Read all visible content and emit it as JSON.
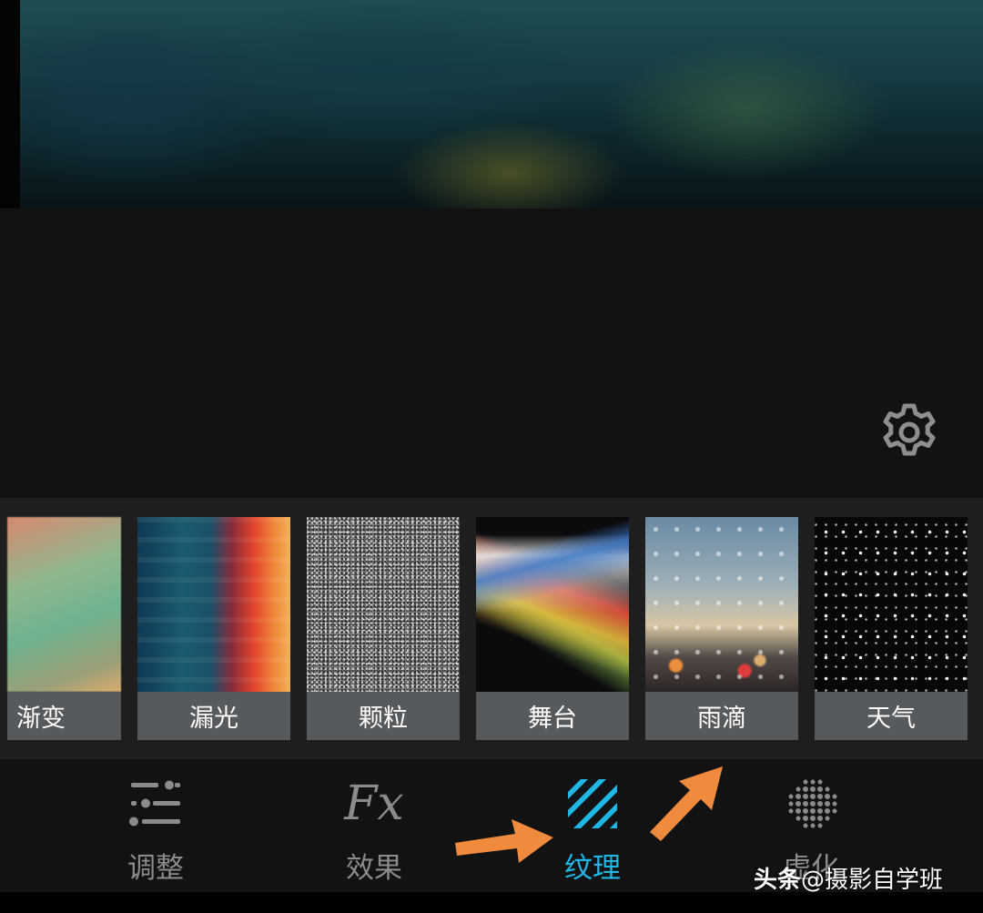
{
  "preview": {
    "image": "night-forest-photo"
  },
  "settings": {
    "icon": "gear-icon"
  },
  "textures": [
    {
      "label": "渐变",
      "thumb": "gradient"
    },
    {
      "label": "漏光",
      "thumb": "light-leak"
    },
    {
      "label": "颗粒",
      "thumb": "grain"
    },
    {
      "label": "舞台",
      "thumb": "stage"
    },
    {
      "label": "雨滴",
      "thumb": "raindrops"
    },
    {
      "label": "天气",
      "thumb": "weather"
    }
  ],
  "nav": {
    "items": [
      {
        "label": "调整",
        "icon": "sliders-icon"
      },
      {
        "label": "效果",
        "icon": "fx-icon",
        "glyph": "Fx"
      },
      {
        "label": "纹理",
        "icon": "texture-stripes-icon",
        "active": true
      },
      {
        "label": "虚化",
        "icon": "dot-grid-icon"
      }
    ]
  },
  "annotations": {
    "arrow_color": "#f08a3c"
  },
  "watermark": {
    "brand": "头条",
    "text": "@摄影自学班"
  },
  "colors": {
    "accent": "#1fb8e6",
    "label_bg": "#575a5d",
    "inactive": "#8b8b8b"
  }
}
